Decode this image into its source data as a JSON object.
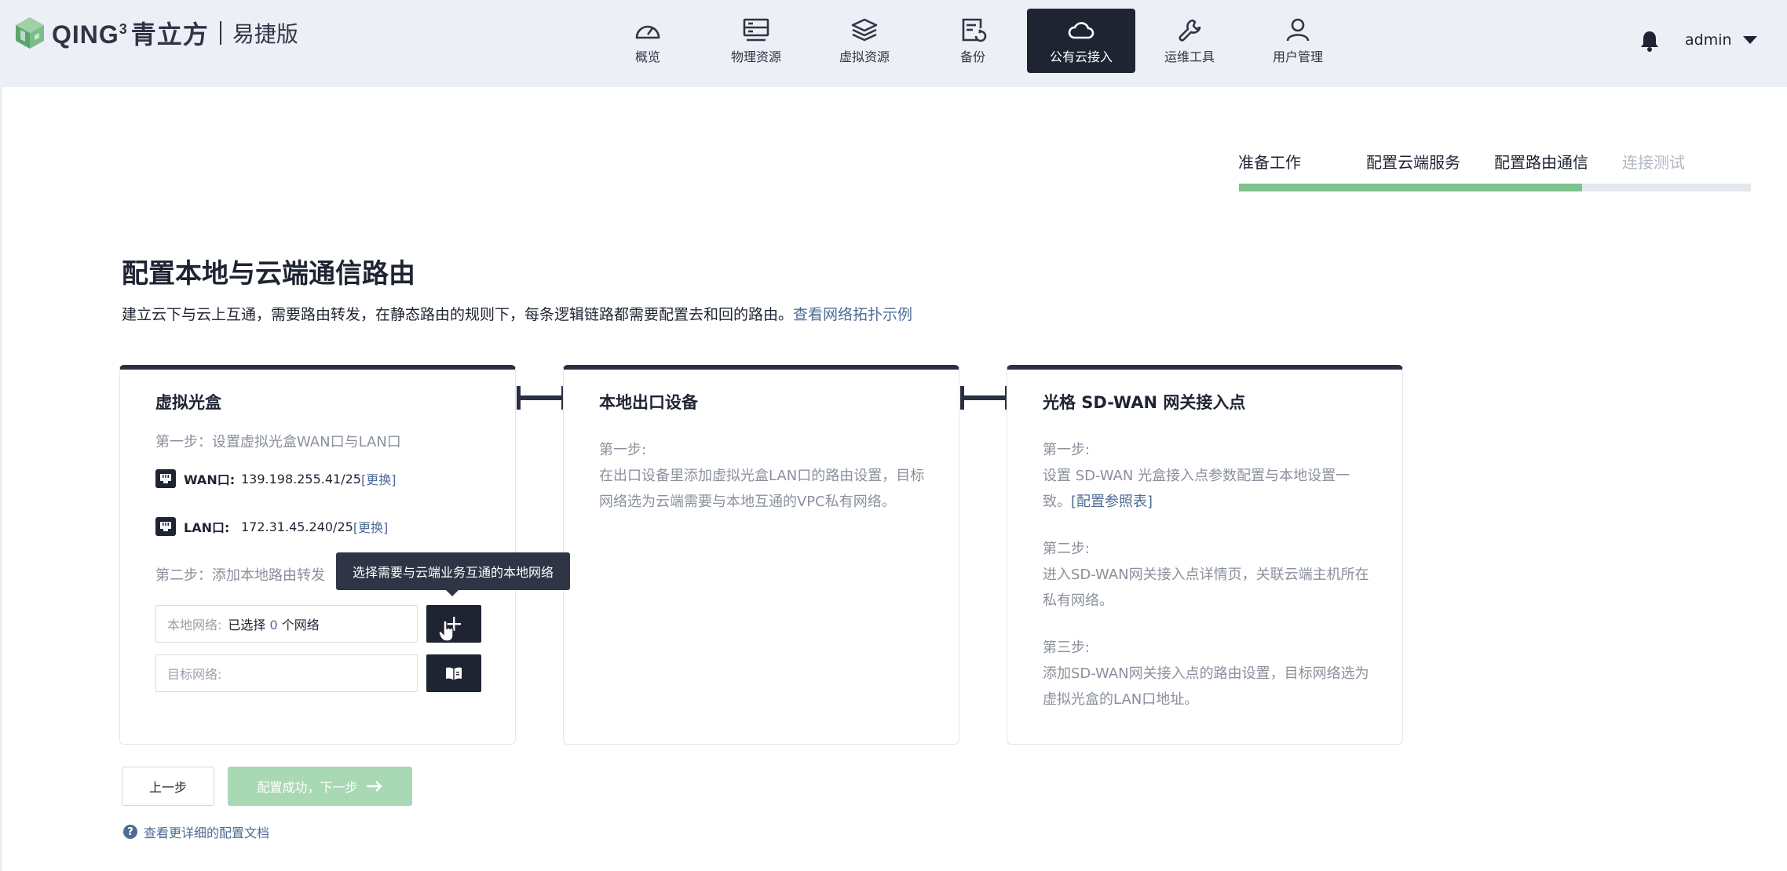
{
  "brand": {
    "name": "QING",
    "superscript": "3",
    "cn_name": "青立方",
    "edition": "易捷版",
    "colors": {
      "cube_dark": "#5aa56b",
      "cube_light": "#9fd1a8"
    }
  },
  "nav": {
    "items": [
      {
        "label": "概览",
        "icon": "dashboard-gauge-icon"
      },
      {
        "label": "物理资源",
        "icon": "server-icon"
      },
      {
        "label": "虚拟资源",
        "icon": "layers-icon"
      },
      {
        "label": "备份",
        "icon": "backup-document-icon"
      },
      {
        "label": "公有云接入",
        "icon": "cloud-icon",
        "active": true
      },
      {
        "label": "运维工具",
        "icon": "wrench-icon"
      },
      {
        "label": "用户管理",
        "icon": "user-icon"
      }
    ]
  },
  "header": {
    "user": "admin"
  },
  "steps": {
    "items": [
      "准备工作",
      "配置云端服务",
      "配置路由通信",
      "连接测试"
    ],
    "progress_fraction": 0.67
  },
  "page": {
    "title": "配置本地与云端通信路由",
    "description": "建立云下与云上互通，需要路由转发，在静态路由的规则下，每条逻辑链路都需要配置去和回的路由。",
    "description_link": "查看网络拓扑示例"
  },
  "card1": {
    "title": "虚拟光盒",
    "step1": "第一步：设置虚拟光盒WAN口与LAN口",
    "wan": {
      "label": "WAN口:",
      "value": "139.198.255.41/25",
      "action": "[更换]"
    },
    "lan": {
      "label": "LAN口:",
      "value": "172.31.45.240/25",
      "action": "[更换]"
    },
    "step2": "第二步：添加本地路由转发",
    "local_network": {
      "label": "本地网络:",
      "prefix": "已选择 ",
      "count": "0",
      "suffix": " 个网络"
    },
    "target_network": {
      "label": "目标网络:",
      "value": ""
    },
    "tooltip": "选择需要与云端业务互通的本地网络"
  },
  "card2": {
    "title": "本地出口设备",
    "step1": "第一步:",
    "step1_text": "在出口设备里添加虚拟光盒LAN口的路由设置，目标网络选为云端需要与本地互通的VPC私有网络。"
  },
  "card3": {
    "title": "光格 SD-WAN 网关接入点",
    "step1": "第一步:",
    "step1_text": "设置 SD-WAN 光盒接入点参数配置与本地设置一致。",
    "step1_link": "[配置参照表]",
    "step2": "第二步:",
    "step2_text": "进入SD-WAN网关接入点详情页，关联云端主机所在私有网络。",
    "step3": "第三步:",
    "step3_text": "添加SD-WAN网关接入点的路由设置，目标网络选为虚拟光盒的LAN口地址。"
  },
  "footer": {
    "prev": "上一步",
    "next": "配置成功，下一步",
    "help": "查看更详细的配置文档"
  },
  "colors": {
    "primary_dark": "#1f2433",
    "link": "#4d6b94",
    "progress": "#7ec28f",
    "disabled_button": "#a9d8b5"
  }
}
